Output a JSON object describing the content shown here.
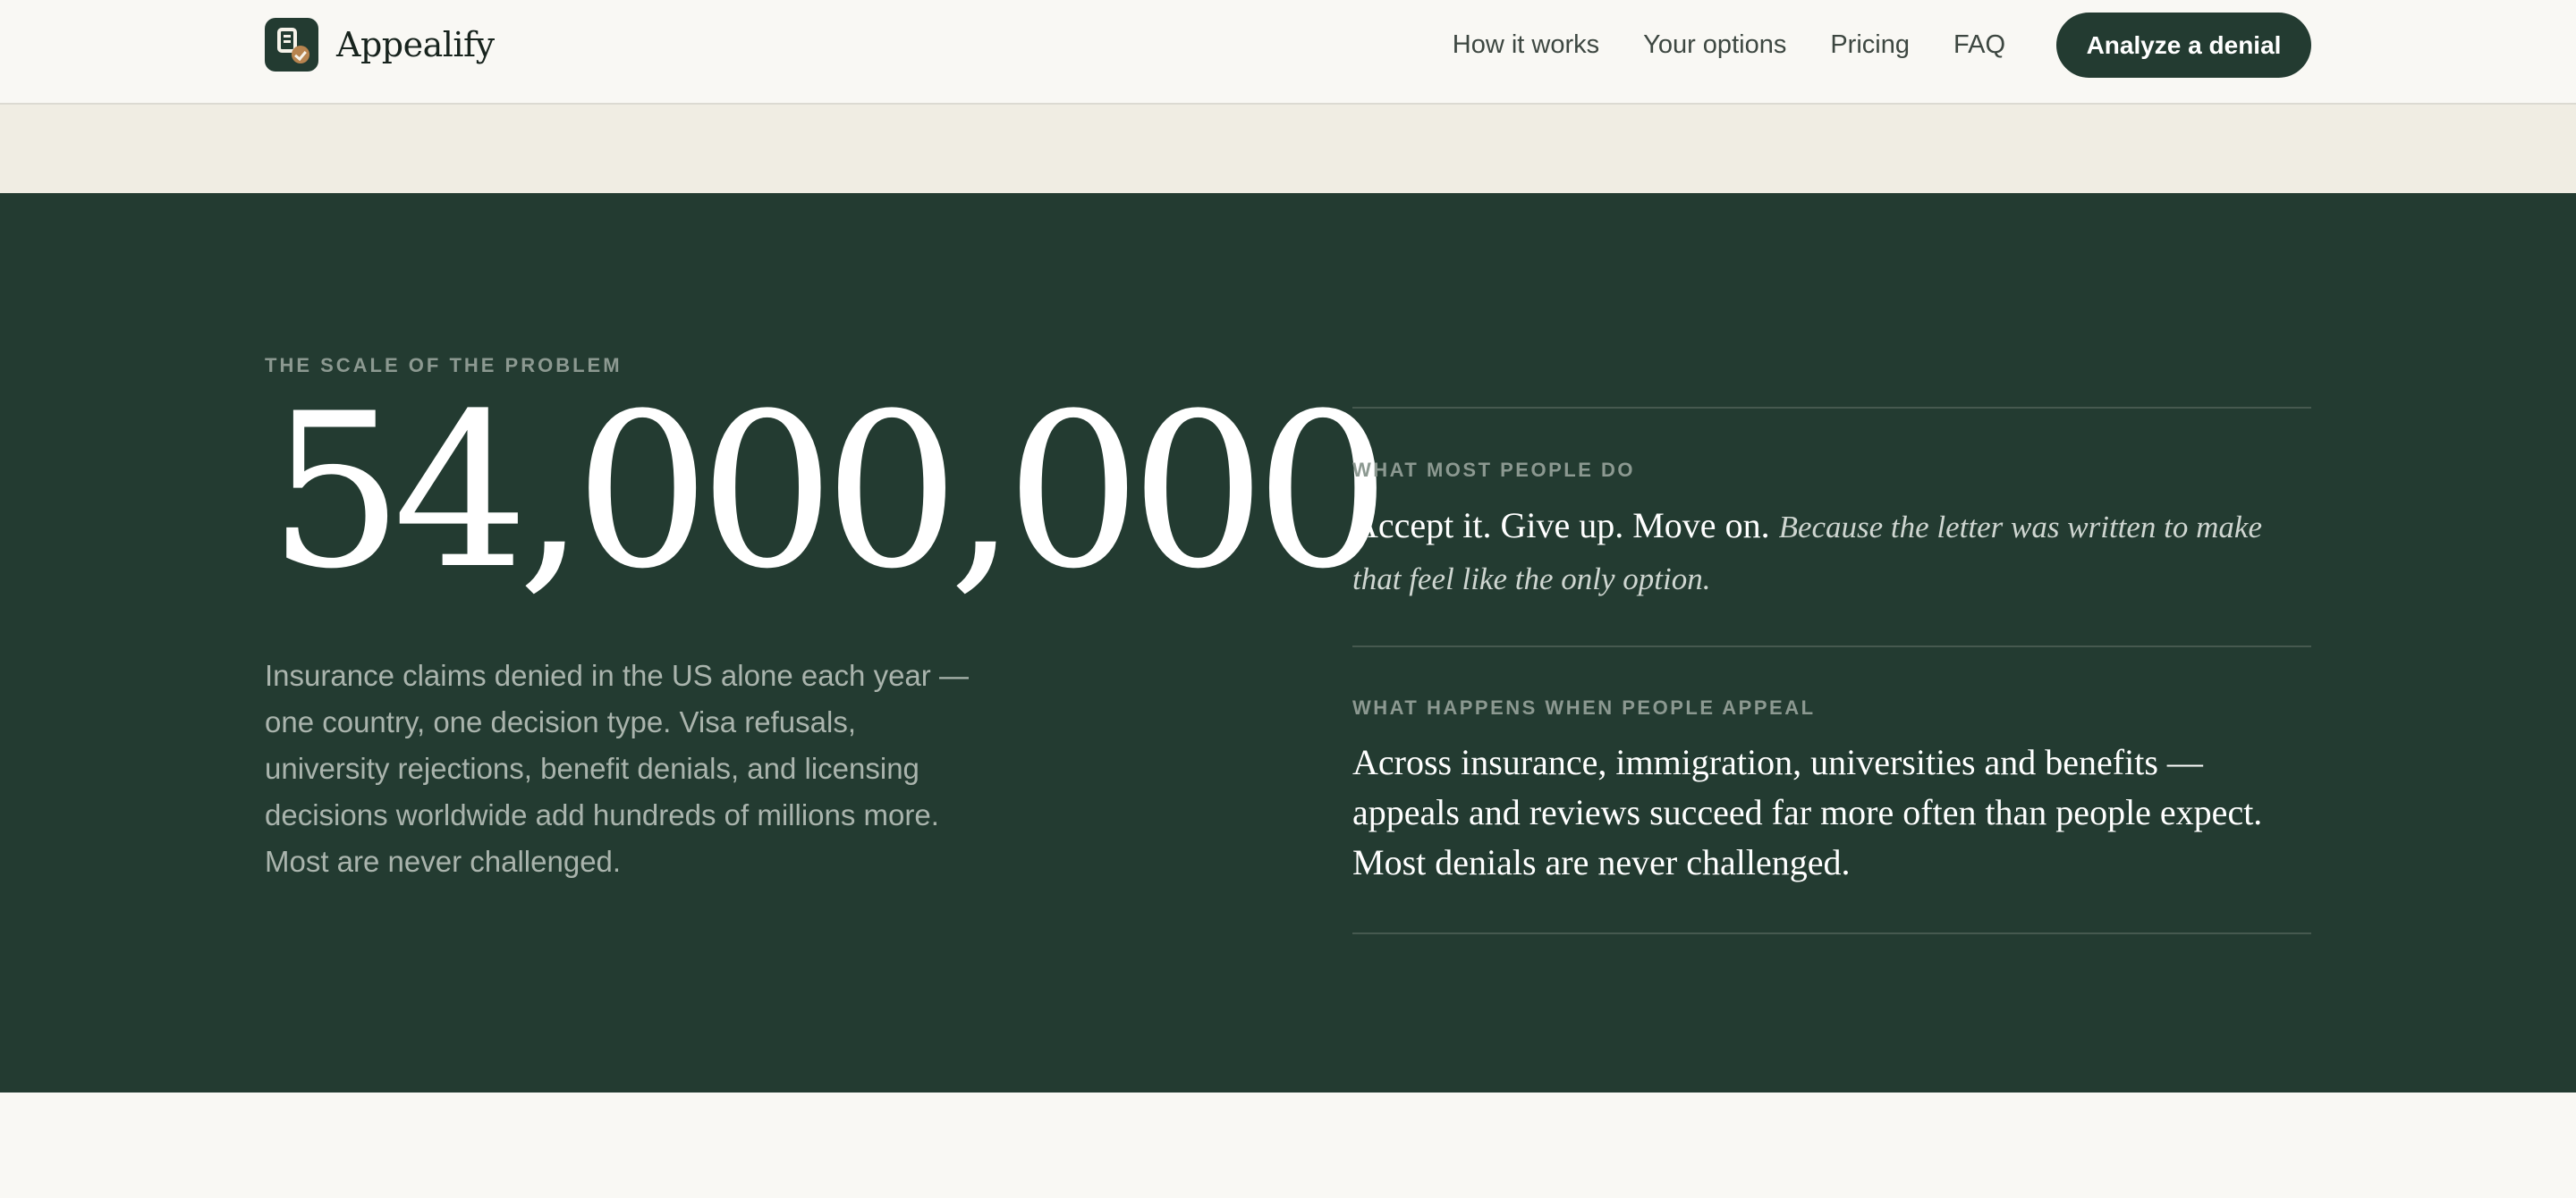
{
  "brand": {
    "name": "Appealify"
  },
  "nav": {
    "links": [
      "How it works",
      "Your options",
      "Pricing",
      "FAQ"
    ],
    "cta_label": "Analyze a denial"
  },
  "stats": {
    "eyebrow": "THE SCALE OF THE PROBLEM",
    "number": "54,000,000",
    "description": "Insurance claims denied in the US alone each year — one country, one decision type. Visa refusals, university rejections, benefit denials, and licensing decisions worldwide add hundreds of millions more. Most are never challenged."
  },
  "most_people": {
    "eyebrow": "WHAT MOST PEOPLE DO",
    "statement": "Accept it. Give up. Move on.",
    "aside": "Because the letter was written to make that feel like the only option."
  },
  "appeal": {
    "eyebrow": "WHAT HAPPENS WHEN PEOPLE APPEAL",
    "statement": "Across insurance, immigration, universities and benefits — appeals and reviews succeed far more often than people expect. Most denials are never challenged."
  },
  "colors": {
    "brand_dark": "#233b31",
    "page_bg": "#f9f8f4",
    "band_bg": "#f0ede3",
    "accent_check": "#b8844f"
  },
  "icons": {
    "logo": "document-check-icon"
  }
}
